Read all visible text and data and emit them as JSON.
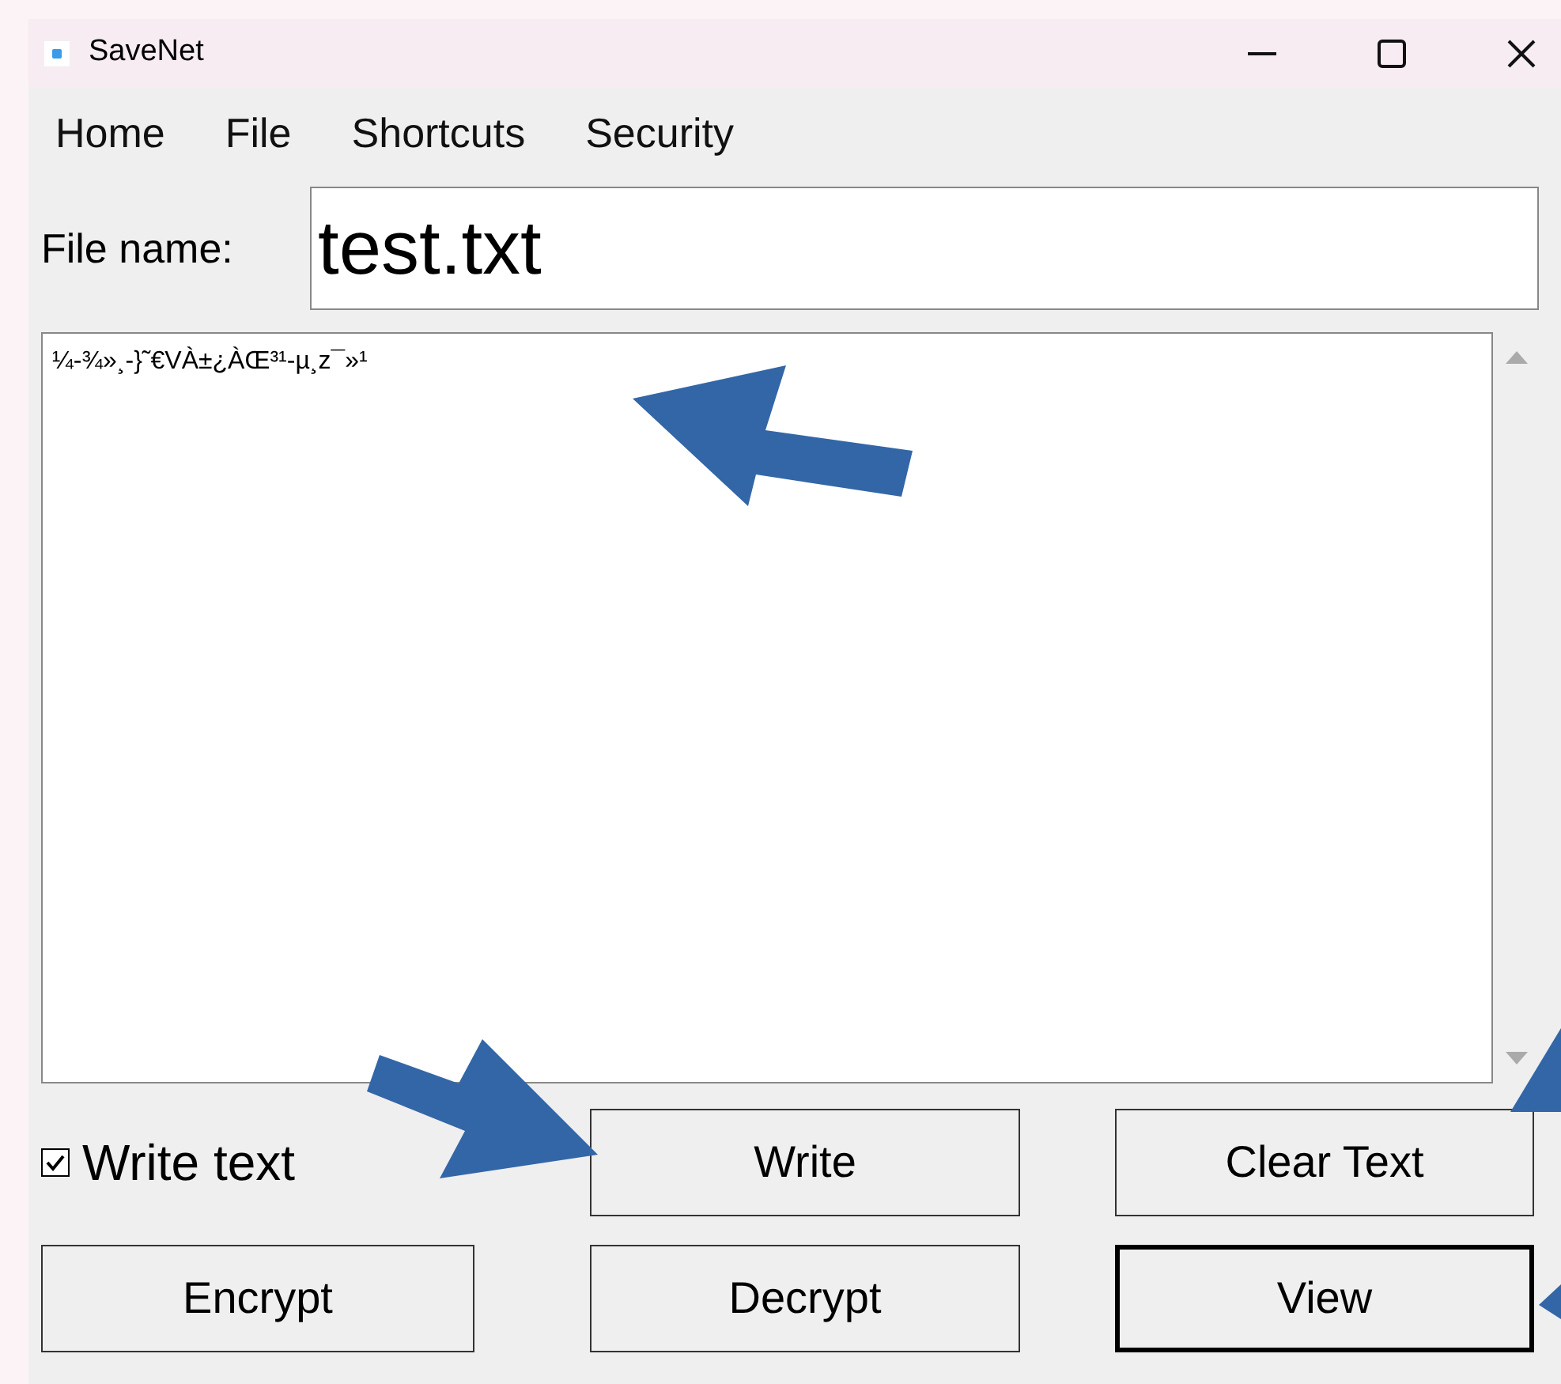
{
  "window": {
    "title": "SaveNet"
  },
  "menu": [
    "Home",
    "File",
    "Shortcuts",
    "Security"
  ],
  "file_name": {
    "label": "File name:",
    "value": "test.txt"
  },
  "content": {
    "value": "¼-¾»¸-}˜€VÀ±¿ÀŒ³¹-µ¸z¯»¹"
  },
  "write_text": {
    "label": "Write text",
    "checked": true
  },
  "buttons": [
    {
      "label": "Write",
      "focused": false
    },
    {
      "label": "Clear Text",
      "focused": false
    },
    {
      "label": "Encrypt",
      "focused": false
    },
    {
      "label": "Decrypt",
      "focused": false
    },
    {
      "label": "View",
      "focused": true
    }
  ]
}
